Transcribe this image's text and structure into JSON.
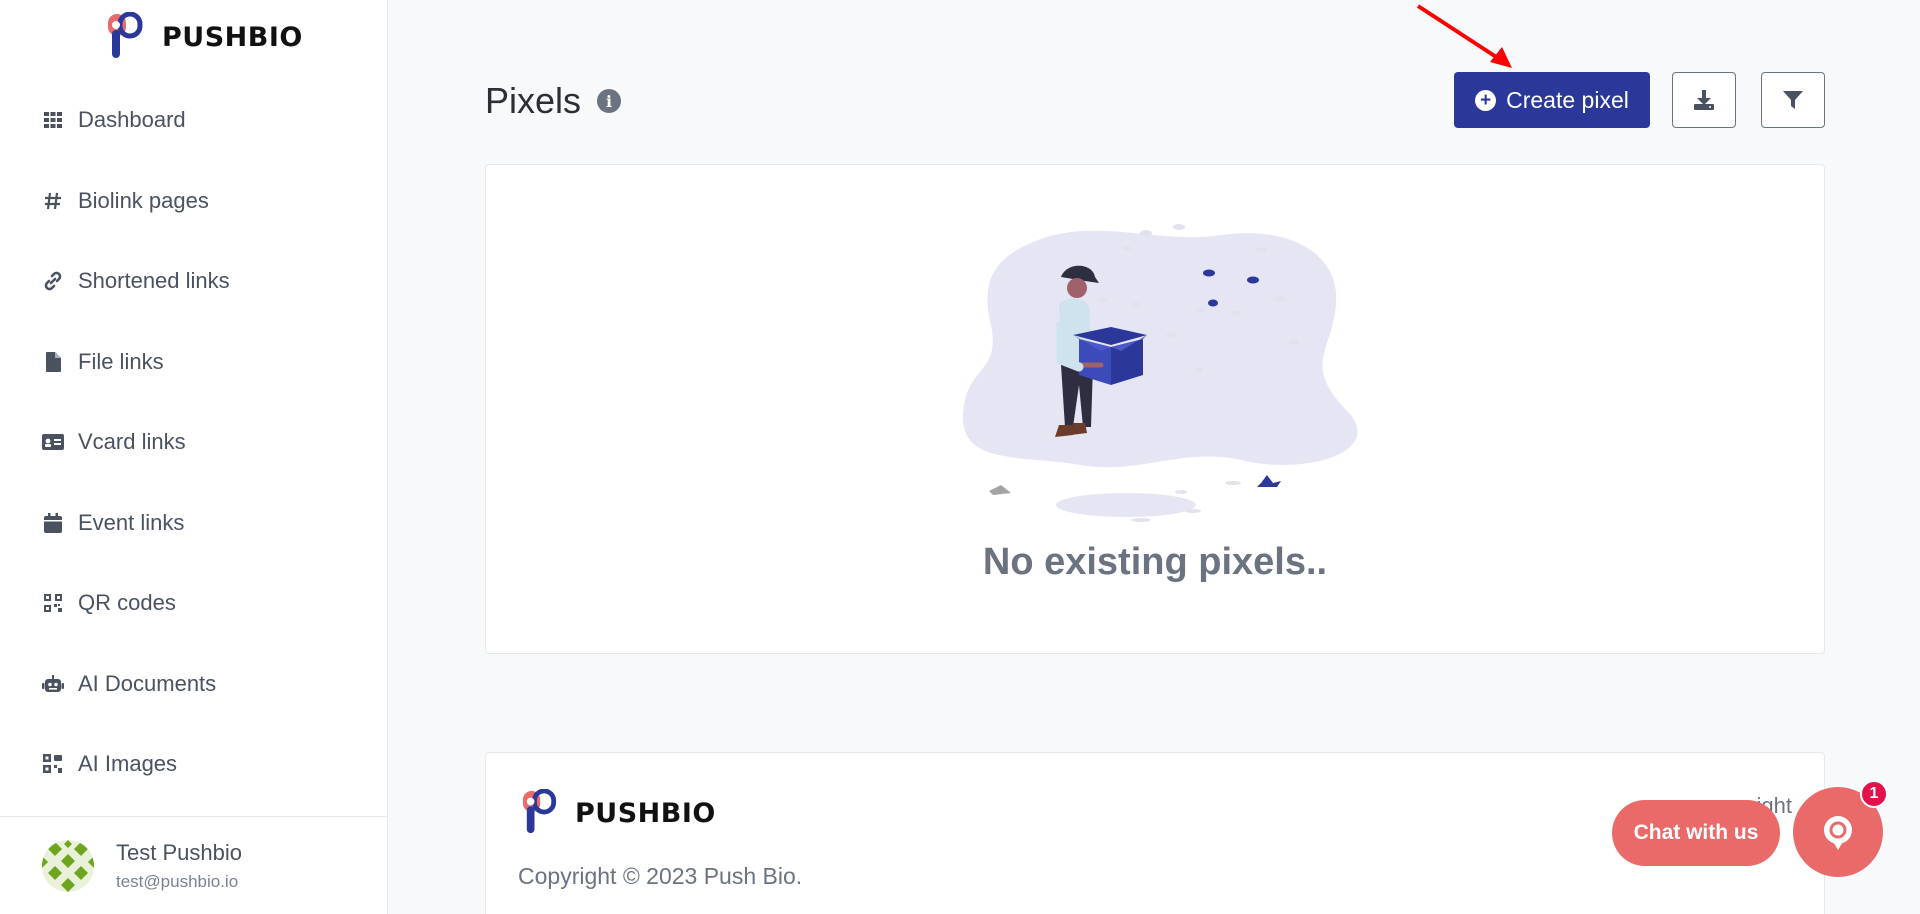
{
  "brand": {
    "name": "PUSHBIO"
  },
  "sidebar": {
    "items": [
      {
        "label": "Dashboard",
        "icon": "grid-icon"
      },
      {
        "label": "Biolink pages",
        "icon": "hashtag-icon"
      },
      {
        "label": "Shortened links",
        "icon": "link-icon"
      },
      {
        "label": "File links",
        "icon": "file-icon"
      },
      {
        "label": "Vcard links",
        "icon": "id-card-icon"
      },
      {
        "label": "Event links",
        "icon": "calendar-icon"
      },
      {
        "label": "QR codes",
        "icon": "qrcode-icon"
      },
      {
        "label": "AI Documents",
        "icon": "robot-icon"
      },
      {
        "label": "AI Images",
        "icon": "images-icon"
      }
    ]
  },
  "user": {
    "name": "Test Pushbio",
    "email": "test@pushbio.io"
  },
  "page": {
    "title": "Pixels",
    "create_label": "Create pixel",
    "empty_message": "No existing pixels.."
  },
  "footer": {
    "brand": "PUSHBIO",
    "copyright": "Copyright © 2023 Push Bio.",
    "right_text": "ight"
  },
  "chat": {
    "label": "Chat with us",
    "badge": "1"
  },
  "colors": {
    "primary": "#2b389a",
    "chat": "#ea6a6a",
    "badge": "#e3124a",
    "annotation": "#ff0000"
  }
}
